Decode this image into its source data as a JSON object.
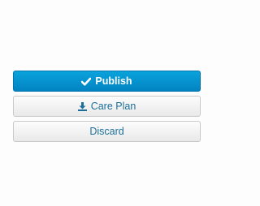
{
  "actions": {
    "publish": {
      "label": "Publish",
      "icon": "checkmark-icon"
    },
    "care_plan": {
      "label": "Care Plan",
      "icon": "download-icon"
    },
    "discard": {
      "label": "Discard"
    }
  },
  "colors": {
    "primary": "#0283c2",
    "primary_text": "#ffffff",
    "secondary_text": "#1d6f9a"
  }
}
